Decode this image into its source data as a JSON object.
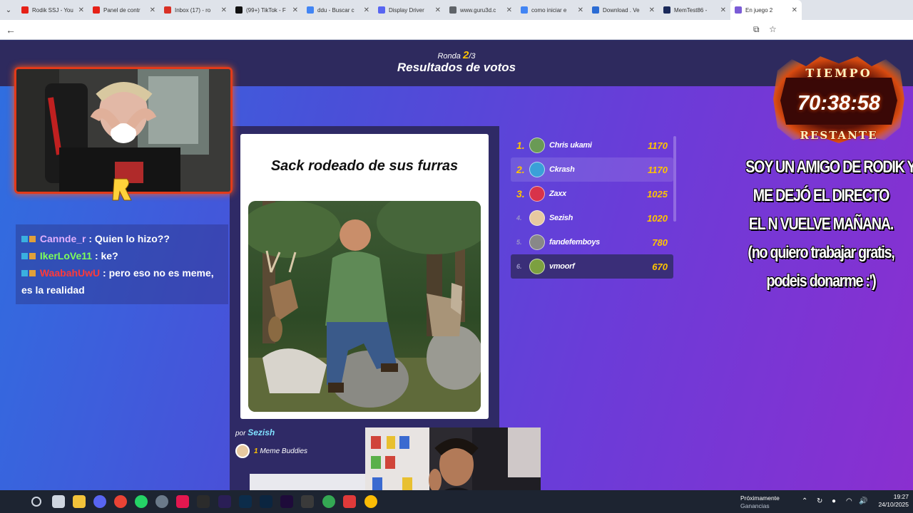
{
  "browser": {
    "tabs": [
      {
        "label": "Rodik SSJ - You",
        "color": "#e62117"
      },
      {
        "label": "Panel de contr",
        "color": "#e62117"
      },
      {
        "label": "Inbox (17) - ro",
        "color": "#d93025"
      },
      {
        "label": "(99+) TikTok - F",
        "color": "#111111"
      },
      {
        "label": "ddu - Buscar c",
        "color": "#4285f4"
      },
      {
        "label": "Display Driver",
        "color": "#5865f2"
      },
      {
        "label": "www.guru3d.c",
        "color": "#5f6368"
      },
      {
        "label": "como iniciar e",
        "color": "#4285f4"
      },
      {
        "label": "Download . Ve",
        "color": "#2b6cd4"
      },
      {
        "label": "MemTest86 -",
        "color": "#1b2a5a"
      },
      {
        "label": "En juego 2",
        "color": "#7b5cd6"
      }
    ]
  },
  "game": {
    "round_label": "Ronda",
    "round_current": "2",
    "round_total": "/3",
    "title": "Resultados de votos",
    "meme": {
      "caption": "Sack rodeado de sus furras",
      "by_prefix": "por",
      "author": "Sezish",
      "buddies_count": "1",
      "buddies_label": "Meme Buddies"
    },
    "leaderboard": [
      {
        "rank": "1.",
        "name": "Chris ukami",
        "points": "1170",
        "color": "#6a9a55"
      },
      {
        "rank": "2.",
        "name": "Ckrash",
        "points": "1170",
        "color": "#3aa0d8"
      },
      {
        "rank": "3.",
        "name": "Zaxx",
        "points": "1025",
        "color": "#d8334a"
      },
      {
        "rank": "4.",
        "name": "Sezish",
        "points": "1020",
        "color": "#e7c9a0"
      },
      {
        "rank": "5.",
        "name": "fandefemboys",
        "points": "780",
        "color": "#888888"
      },
      {
        "rank": "6.",
        "name": "vmoorf",
        "points": "670",
        "color": "#7ca040"
      }
    ]
  },
  "chat": {
    "messages": [
      {
        "user": "Cannde_r",
        "sep": " : ",
        "text": "Quien lo hizo??"
      },
      {
        "user": "IkerLoVe11",
        "sep": " : ",
        "text": "ke?"
      },
      {
        "user": "WaabahUwU",
        "sep": " : ",
        "text": "pero eso no es meme, es la realidad"
      }
    ]
  },
  "timer": {
    "label": "TIEMPO",
    "value": "70:38:58",
    "sub": "RESTANTE"
  },
  "overlay": {
    "lines": [
      "SOY UN AMIGO DE RODIK Y",
      "ME DEJÓ EL DIRECTO",
      "EL N VUELVE MAÑANA.",
      "(no quiero trabajar gratis,",
      "podeis donarme :')"
    ]
  },
  "taskbar": {
    "notif_title": "Próximamente",
    "notif_sub": "Ganancias",
    "time": "19:27",
    "date": "24/10/2025"
  }
}
